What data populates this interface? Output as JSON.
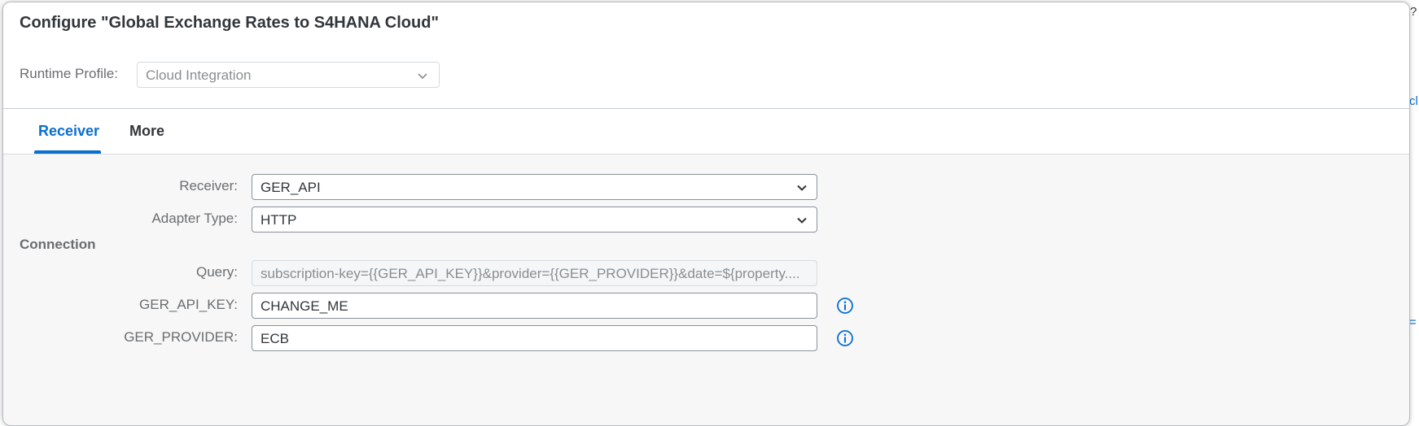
{
  "dialog": {
    "title": "Configure \"Global Exchange Rates to S4HANA Cloud\"",
    "runtime_profile": {
      "label": "Runtime Profile:",
      "value": "Cloud Integration"
    }
  },
  "tabs": [
    {
      "label": "Receiver",
      "selected": true
    },
    {
      "label": "More",
      "selected": false
    }
  ],
  "form": {
    "receiver": {
      "label": "Receiver:",
      "value": "GER_API"
    },
    "adapter_type": {
      "label": "Adapter Type:",
      "value": "HTTP"
    },
    "connection_title": "Connection",
    "query": {
      "label": "Query:",
      "value": "subscription-key={{GER_API_KEY}}&provider={{GER_PROVIDER}}&date=${property...."
    },
    "ger_api_key": {
      "label": "GER_API_KEY:",
      "value": "CHANGE_ME"
    },
    "ger_provider": {
      "label": "GER_PROVIDER:",
      "value": "ECB"
    }
  },
  "background": {
    "right_fragment_top": "cl",
    "right_fragment_mid": "=",
    "help_icon": "?"
  },
  "colors": {
    "accent": "#0a6ed1",
    "text": "#32363a",
    "label": "#6a6d70"
  },
  "icons": {
    "dropdown": "chevron-down-icon",
    "info": "info-icon",
    "help": "question-circle-icon"
  }
}
